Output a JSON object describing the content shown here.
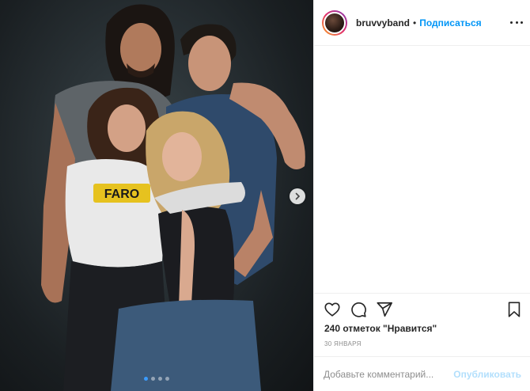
{
  "photo": {
    "alt_icon": "chevron-right-icon",
    "carousel_total": 4,
    "carousel_active_index": 0,
    "shirt_print": "FARO"
  },
  "header": {
    "username": "bruvvyband",
    "separator": "•",
    "follow_label": "Подписаться",
    "more_icon": "more-horizontal-icon"
  },
  "actions": {
    "like_icon": "heart-icon",
    "comment_icon": "comment-icon",
    "share_icon": "paper-plane-icon",
    "save_icon": "bookmark-icon"
  },
  "likes_text": "240 отметок \"Нравится\"",
  "date_text": "30 января",
  "comment": {
    "placeholder": "Добавьте комментарий...",
    "publish_label": "Опубликовать"
  },
  "colors": {
    "accent": "#0095f6",
    "publish_disabled": "#b2dffc",
    "carousel_active": "#3b9cff"
  }
}
